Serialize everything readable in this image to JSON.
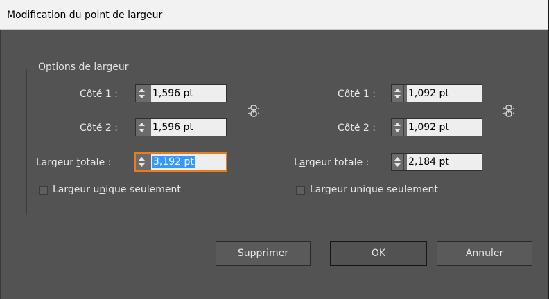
{
  "window": {
    "title": "Modification du point de largeur"
  },
  "group": {
    "legend": "Options de largeur"
  },
  "left": {
    "side1": {
      "label": "Côté 1 :",
      "value": "1,596 pt"
    },
    "side2": {
      "label": "Côté 2 :",
      "value": "1,596 pt"
    },
    "total": {
      "label": "Largeur totale :",
      "value": "3,192 pt"
    },
    "uniform": {
      "label": "Largeur unique seulement",
      "checked": false
    }
  },
  "right": {
    "side1": {
      "label": "Côté 1 :",
      "value": "1,092 pt"
    },
    "side2": {
      "label": "Côté 2 :",
      "value": "1,092 pt"
    },
    "total": {
      "label": "Largeur totale :",
      "value": "2,184 pt"
    },
    "uniform": {
      "label": "Largeur unique seulement",
      "checked": false
    }
  },
  "buttons": {
    "delete": "Supprimer",
    "ok": "OK",
    "cancel": "Annuler"
  },
  "icons": {
    "spinner": "spinner-arrows-icon",
    "link": "link-chain-icon"
  },
  "colors": {
    "panel": "#535353",
    "focus_border": "#e97d19",
    "selection": "#3399ff"
  }
}
